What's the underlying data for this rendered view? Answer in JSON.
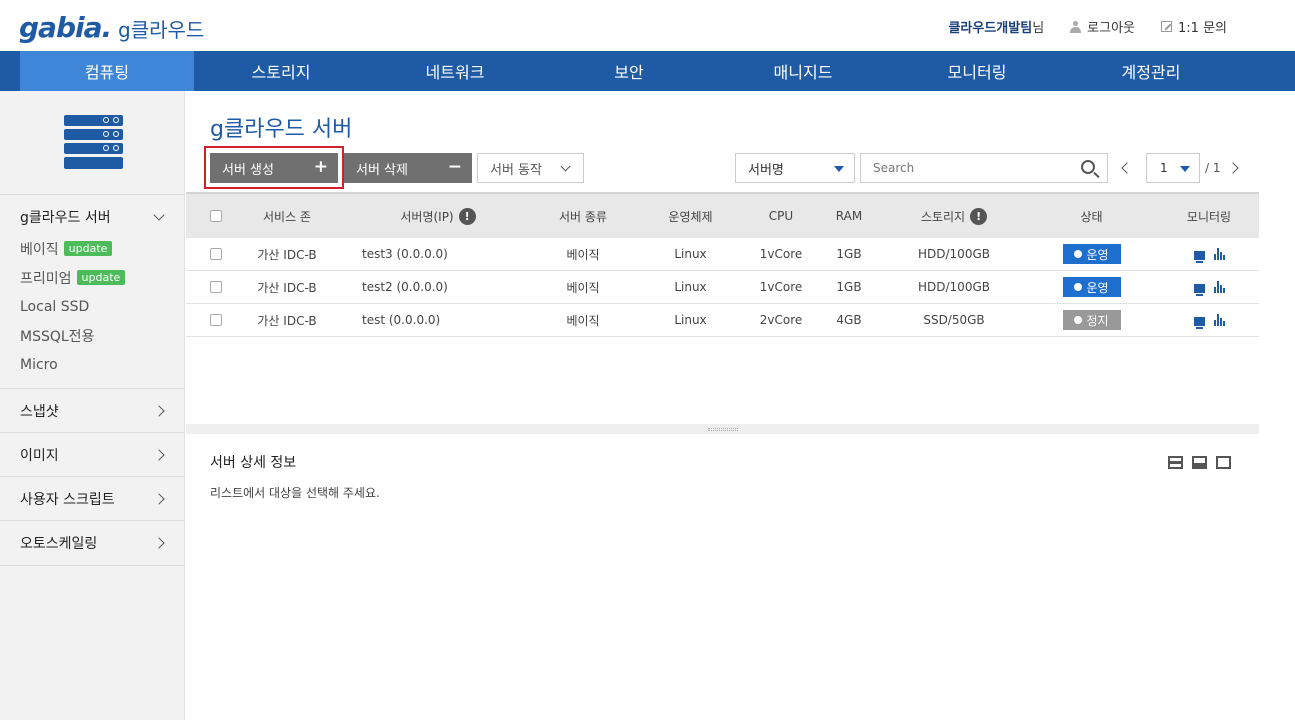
{
  "header": {
    "logo": "gabia.",
    "product": "g클라우드",
    "user_team": "클라우드개발팀",
    "user_suffix": "님",
    "logout": "로그아웃",
    "inquiry": "1:1 문의"
  },
  "nav": {
    "tabs": [
      {
        "label": "컴퓨팅",
        "active": true
      },
      {
        "label": "스토리지"
      },
      {
        "label": "네트워크"
      },
      {
        "label": "보안"
      },
      {
        "label": "매니지드"
      },
      {
        "label": "모니터링"
      },
      {
        "label": "계정관리"
      }
    ]
  },
  "sidebar": {
    "section_server": "g클라우드 서버",
    "sub_items": [
      {
        "label": "베이직",
        "badge": "update"
      },
      {
        "label": "프리미엄",
        "badge": "update"
      },
      {
        "label": "Local SSD"
      },
      {
        "label": "MSSQL전용"
      },
      {
        "label": "Micro"
      }
    ],
    "sections": [
      "스냅샷",
      "이미지",
      "사용자 스크립트",
      "오토스케일링"
    ]
  },
  "main": {
    "title": "g클라우드 서버",
    "create_button": "서버 생성",
    "delete_button": "서버 삭제",
    "action_select": "서버 동작",
    "filter_select": "서버명",
    "search_placeholder": "Search",
    "page_current": "1",
    "page_total": "/ 1"
  },
  "table": {
    "headers": [
      "서비스 존",
      "서버명(IP)",
      "서버 종류",
      "운영체제",
      "CPU",
      "RAM",
      "스토리지",
      "상태",
      "모니터링"
    ],
    "rows": [
      {
        "zone": "가산 IDC-B",
        "name": "test3 (0.0.0.0)",
        "type": "베이직",
        "os": "Linux",
        "cpu": "1vCore",
        "ram": "1GB",
        "storage": "HDD/100GB",
        "status": "운영"
      },
      {
        "zone": "가산 IDC-B",
        "name": "test2 (0.0.0.0)",
        "type": "베이직",
        "os": "Linux",
        "cpu": "1vCore",
        "ram": "1GB",
        "storage": "HDD/100GB",
        "status": "운영"
      },
      {
        "zone": "가산 IDC-B",
        "name": "test (0.0.0.0)",
        "type": "베이직",
        "os": "Linux",
        "cpu": "2vCore",
        "ram": "4GB",
        "storage": "SSD/50GB",
        "status": "정지"
      }
    ]
  },
  "detail": {
    "title": "서버 상세 정보",
    "message": "리스트에서 대상을 선택해 주세요."
  },
  "colors": {
    "brand": "#1f5aa5",
    "nav_active": "#3f86d9",
    "status_running": "#1f6fcf",
    "status_stopped": "#999999",
    "badge_update": "#4cbb5a",
    "highlight_outline": "#d0202c"
  }
}
